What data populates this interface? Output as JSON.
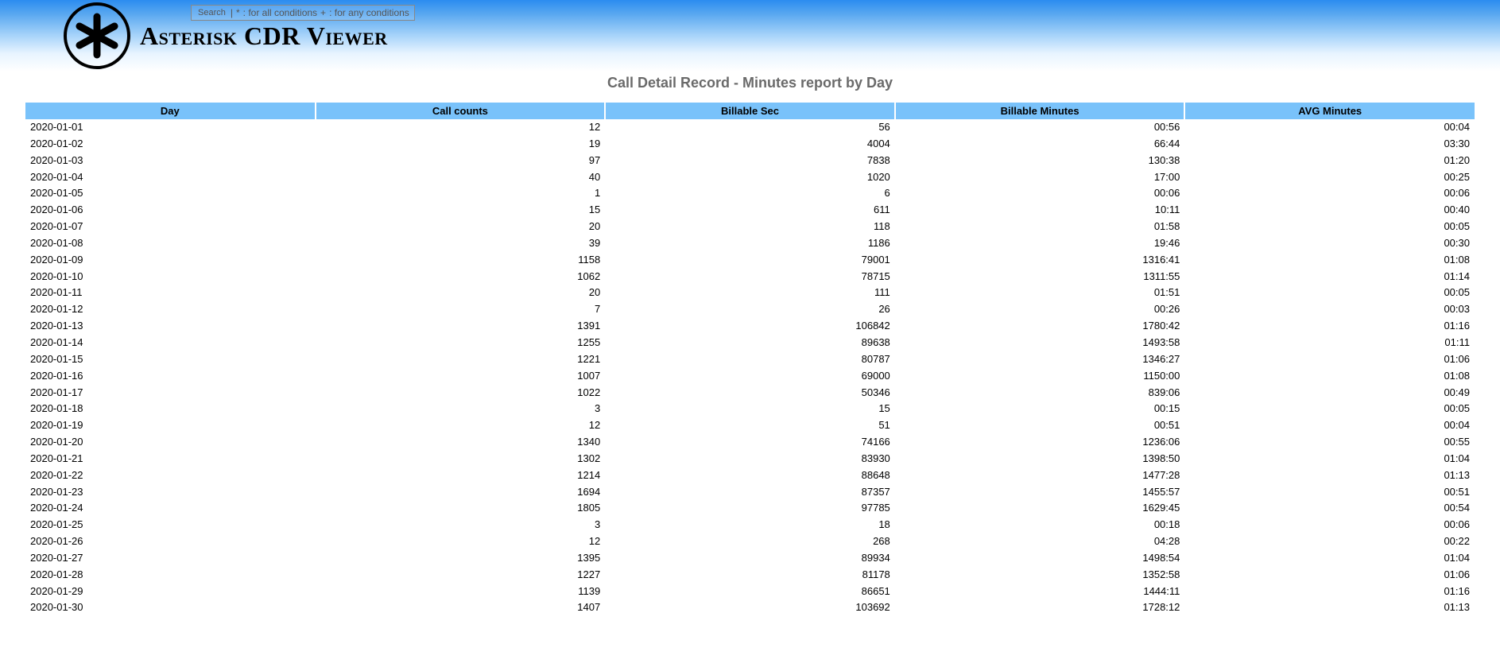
{
  "header": {
    "title": "Asterisk CDR Viewer",
    "search_label": "Search",
    "hint_all": " : for all conditions",
    "hint_any": " : for any conditions",
    "op_all": "*",
    "op_any": "+"
  },
  "report": {
    "title": "Call Detail Record - Minutes report by Day",
    "columns": {
      "day": "Day",
      "calls": "Call counts",
      "sec": "Billable Sec",
      "min": "Billable Minutes",
      "avg": "AVG Minutes"
    },
    "rows": [
      {
        "day": "2020-01-01",
        "calls": "12",
        "sec": "56",
        "min": "00:56",
        "avg": "00:04"
      },
      {
        "day": "2020-01-02",
        "calls": "19",
        "sec": "4004",
        "min": "66:44",
        "avg": "03:30"
      },
      {
        "day": "2020-01-03",
        "calls": "97",
        "sec": "7838",
        "min": "130:38",
        "avg": "01:20"
      },
      {
        "day": "2020-01-04",
        "calls": "40",
        "sec": "1020",
        "min": "17:00",
        "avg": "00:25"
      },
      {
        "day": "2020-01-05",
        "calls": "1",
        "sec": "6",
        "min": "00:06",
        "avg": "00:06"
      },
      {
        "day": "2020-01-06",
        "calls": "15",
        "sec": "611",
        "min": "10:11",
        "avg": "00:40"
      },
      {
        "day": "2020-01-07",
        "calls": "20",
        "sec": "118",
        "min": "01:58",
        "avg": "00:05"
      },
      {
        "day": "2020-01-08",
        "calls": "39",
        "sec": "1186",
        "min": "19:46",
        "avg": "00:30"
      },
      {
        "day": "2020-01-09",
        "calls": "1158",
        "sec": "79001",
        "min": "1316:41",
        "avg": "01:08"
      },
      {
        "day": "2020-01-10",
        "calls": "1062",
        "sec": "78715",
        "min": "1311:55",
        "avg": "01:14"
      },
      {
        "day": "2020-01-11",
        "calls": "20",
        "sec": "111",
        "min": "01:51",
        "avg": "00:05"
      },
      {
        "day": "2020-01-12",
        "calls": "7",
        "sec": "26",
        "min": "00:26",
        "avg": "00:03"
      },
      {
        "day": "2020-01-13",
        "calls": "1391",
        "sec": "106842",
        "min": "1780:42",
        "avg": "01:16"
      },
      {
        "day": "2020-01-14",
        "calls": "1255",
        "sec": "89638",
        "min": "1493:58",
        "avg": "01:11"
      },
      {
        "day": "2020-01-15",
        "calls": "1221",
        "sec": "80787",
        "min": "1346:27",
        "avg": "01:06"
      },
      {
        "day": "2020-01-16",
        "calls": "1007",
        "sec": "69000",
        "min": "1150:00",
        "avg": "01:08"
      },
      {
        "day": "2020-01-17",
        "calls": "1022",
        "sec": "50346",
        "min": "839:06",
        "avg": "00:49"
      },
      {
        "day": "2020-01-18",
        "calls": "3",
        "sec": "15",
        "min": "00:15",
        "avg": "00:05"
      },
      {
        "day": "2020-01-19",
        "calls": "12",
        "sec": "51",
        "min": "00:51",
        "avg": "00:04"
      },
      {
        "day": "2020-01-20",
        "calls": "1340",
        "sec": "74166",
        "min": "1236:06",
        "avg": "00:55"
      },
      {
        "day": "2020-01-21",
        "calls": "1302",
        "sec": "83930",
        "min": "1398:50",
        "avg": "01:04"
      },
      {
        "day": "2020-01-22",
        "calls": "1214",
        "sec": "88648",
        "min": "1477:28",
        "avg": "01:13"
      },
      {
        "day": "2020-01-23",
        "calls": "1694",
        "sec": "87357",
        "min": "1455:57",
        "avg": "00:51"
      },
      {
        "day": "2020-01-24",
        "calls": "1805",
        "sec": "97785",
        "min": "1629:45",
        "avg": "00:54"
      },
      {
        "day": "2020-01-25",
        "calls": "3",
        "sec": "18",
        "min": "00:18",
        "avg": "00:06"
      },
      {
        "day": "2020-01-26",
        "calls": "12",
        "sec": "268",
        "min": "04:28",
        "avg": "00:22"
      },
      {
        "day": "2020-01-27",
        "calls": "1395",
        "sec": "89934",
        "min": "1498:54",
        "avg": "01:04"
      },
      {
        "day": "2020-01-28",
        "calls": "1227",
        "sec": "81178",
        "min": "1352:58",
        "avg": "01:06"
      },
      {
        "day": "2020-01-29",
        "calls": "1139",
        "sec": "86651",
        "min": "1444:11",
        "avg": "01:16"
      },
      {
        "day": "2020-01-30",
        "calls": "1407",
        "sec": "103692",
        "min": "1728:12",
        "avg": "01:13"
      }
    ]
  }
}
